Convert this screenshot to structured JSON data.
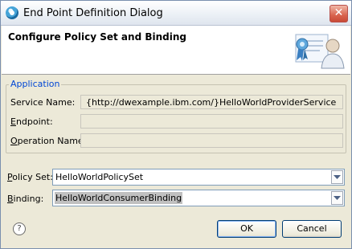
{
  "window": {
    "title": "End Point Definition Dialog",
    "close_glyph": "✕"
  },
  "banner": {
    "title": "Configure Policy Set and Binding",
    "icon": "certificate-user-icon"
  },
  "application": {
    "legend": "Application",
    "service_name": {
      "label": "Service Name:",
      "value": "{http://dwexample.ibm.com/}HelloWorldProviderService"
    },
    "endpoint": {
      "label_prefix": "",
      "label_accel": "E",
      "label_rest": "ndpoint:",
      "value": ""
    },
    "operation_name": {
      "label_accel": "O",
      "label_rest": "peration Name:",
      "value": ""
    }
  },
  "policy_set": {
    "label_accel": "P",
    "label_rest": "olicy Set:",
    "value": "HelloWorldPolicySet"
  },
  "binding": {
    "label_accel": "B",
    "label_rest": "inding:",
    "value": "HelloWorldConsumerBinding"
  },
  "buttons": {
    "ok": "OK",
    "cancel": "Cancel",
    "help": "?"
  }
}
